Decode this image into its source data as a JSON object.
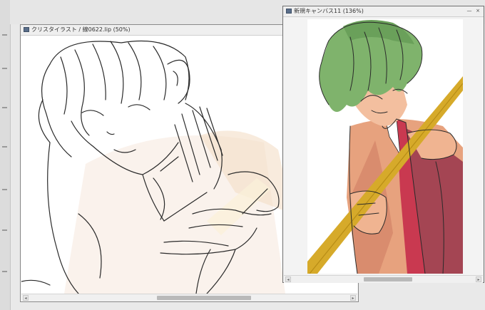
{
  "left_window": {
    "title": "クリスタイラスト / 線0622.lip (50%)"
  },
  "right_window": {
    "title": "新規キャンバス11 (136%)",
    "minimize_label": "—",
    "close_label": "×"
  },
  "scroll": {
    "left_arrow": "◂",
    "right_arrow": "▸"
  },
  "icons": {
    "doc": "document-icon",
    "scroll_left": "scroll-left-arrow-icon",
    "scroll_right": "scroll-right-arrow-icon"
  },
  "colors": {
    "hair_green": "#7fb36c",
    "skin": "#e7a27e",
    "tie_red": "#c93950",
    "jacket_dark": "#9c3b4f",
    "staff_gold": "#d6aa2a",
    "window_border": "#8a8a8a"
  }
}
